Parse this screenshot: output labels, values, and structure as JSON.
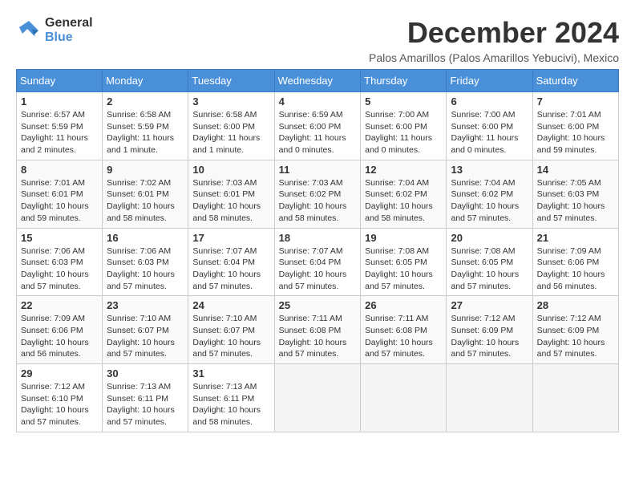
{
  "header": {
    "logo_general": "General",
    "logo_blue": "Blue",
    "month_title": "December 2024",
    "subtitle": "Palos Amarillos (Palos Amarillos Yebucivi), Mexico"
  },
  "days_of_week": [
    "Sunday",
    "Monday",
    "Tuesday",
    "Wednesday",
    "Thursday",
    "Friday",
    "Saturday"
  ],
  "weeks": [
    [
      {
        "day": "1",
        "info": "Sunrise: 6:57 AM\nSunset: 5:59 PM\nDaylight: 11 hours and 2 minutes."
      },
      {
        "day": "2",
        "info": "Sunrise: 6:58 AM\nSunset: 5:59 PM\nDaylight: 11 hours and 1 minute."
      },
      {
        "day": "3",
        "info": "Sunrise: 6:58 AM\nSunset: 6:00 PM\nDaylight: 11 hours and 1 minute."
      },
      {
        "day": "4",
        "info": "Sunrise: 6:59 AM\nSunset: 6:00 PM\nDaylight: 11 hours and 0 minutes."
      },
      {
        "day": "5",
        "info": "Sunrise: 7:00 AM\nSunset: 6:00 PM\nDaylight: 11 hours and 0 minutes."
      },
      {
        "day": "6",
        "info": "Sunrise: 7:00 AM\nSunset: 6:00 PM\nDaylight: 11 hours and 0 minutes."
      },
      {
        "day": "7",
        "info": "Sunrise: 7:01 AM\nSunset: 6:00 PM\nDaylight: 10 hours and 59 minutes."
      }
    ],
    [
      {
        "day": "8",
        "info": "Sunrise: 7:01 AM\nSunset: 6:01 PM\nDaylight: 10 hours and 59 minutes."
      },
      {
        "day": "9",
        "info": "Sunrise: 7:02 AM\nSunset: 6:01 PM\nDaylight: 10 hours and 58 minutes."
      },
      {
        "day": "10",
        "info": "Sunrise: 7:03 AM\nSunset: 6:01 PM\nDaylight: 10 hours and 58 minutes."
      },
      {
        "day": "11",
        "info": "Sunrise: 7:03 AM\nSunset: 6:02 PM\nDaylight: 10 hours and 58 minutes."
      },
      {
        "day": "12",
        "info": "Sunrise: 7:04 AM\nSunset: 6:02 PM\nDaylight: 10 hours and 58 minutes."
      },
      {
        "day": "13",
        "info": "Sunrise: 7:04 AM\nSunset: 6:02 PM\nDaylight: 10 hours and 57 minutes."
      },
      {
        "day": "14",
        "info": "Sunrise: 7:05 AM\nSunset: 6:03 PM\nDaylight: 10 hours and 57 minutes."
      }
    ],
    [
      {
        "day": "15",
        "info": "Sunrise: 7:06 AM\nSunset: 6:03 PM\nDaylight: 10 hours and 57 minutes."
      },
      {
        "day": "16",
        "info": "Sunrise: 7:06 AM\nSunset: 6:03 PM\nDaylight: 10 hours and 57 minutes."
      },
      {
        "day": "17",
        "info": "Sunrise: 7:07 AM\nSunset: 6:04 PM\nDaylight: 10 hours and 57 minutes."
      },
      {
        "day": "18",
        "info": "Sunrise: 7:07 AM\nSunset: 6:04 PM\nDaylight: 10 hours and 57 minutes."
      },
      {
        "day": "19",
        "info": "Sunrise: 7:08 AM\nSunset: 6:05 PM\nDaylight: 10 hours and 57 minutes."
      },
      {
        "day": "20",
        "info": "Sunrise: 7:08 AM\nSunset: 6:05 PM\nDaylight: 10 hours and 57 minutes."
      },
      {
        "day": "21",
        "info": "Sunrise: 7:09 AM\nSunset: 6:06 PM\nDaylight: 10 hours and 56 minutes."
      }
    ],
    [
      {
        "day": "22",
        "info": "Sunrise: 7:09 AM\nSunset: 6:06 PM\nDaylight: 10 hours and 56 minutes."
      },
      {
        "day": "23",
        "info": "Sunrise: 7:10 AM\nSunset: 6:07 PM\nDaylight: 10 hours and 57 minutes."
      },
      {
        "day": "24",
        "info": "Sunrise: 7:10 AM\nSunset: 6:07 PM\nDaylight: 10 hours and 57 minutes."
      },
      {
        "day": "25",
        "info": "Sunrise: 7:11 AM\nSunset: 6:08 PM\nDaylight: 10 hours and 57 minutes."
      },
      {
        "day": "26",
        "info": "Sunrise: 7:11 AM\nSunset: 6:08 PM\nDaylight: 10 hours and 57 minutes."
      },
      {
        "day": "27",
        "info": "Sunrise: 7:12 AM\nSunset: 6:09 PM\nDaylight: 10 hours and 57 minutes."
      },
      {
        "day": "28",
        "info": "Sunrise: 7:12 AM\nSunset: 6:09 PM\nDaylight: 10 hours and 57 minutes."
      }
    ],
    [
      {
        "day": "29",
        "info": "Sunrise: 7:12 AM\nSunset: 6:10 PM\nDaylight: 10 hours and 57 minutes."
      },
      {
        "day": "30",
        "info": "Sunrise: 7:13 AM\nSunset: 6:11 PM\nDaylight: 10 hours and 57 minutes."
      },
      {
        "day": "31",
        "info": "Sunrise: 7:13 AM\nSunset: 6:11 PM\nDaylight: 10 hours and 58 minutes."
      },
      {
        "day": "",
        "info": ""
      },
      {
        "day": "",
        "info": ""
      },
      {
        "day": "",
        "info": ""
      },
      {
        "day": "",
        "info": ""
      }
    ]
  ]
}
